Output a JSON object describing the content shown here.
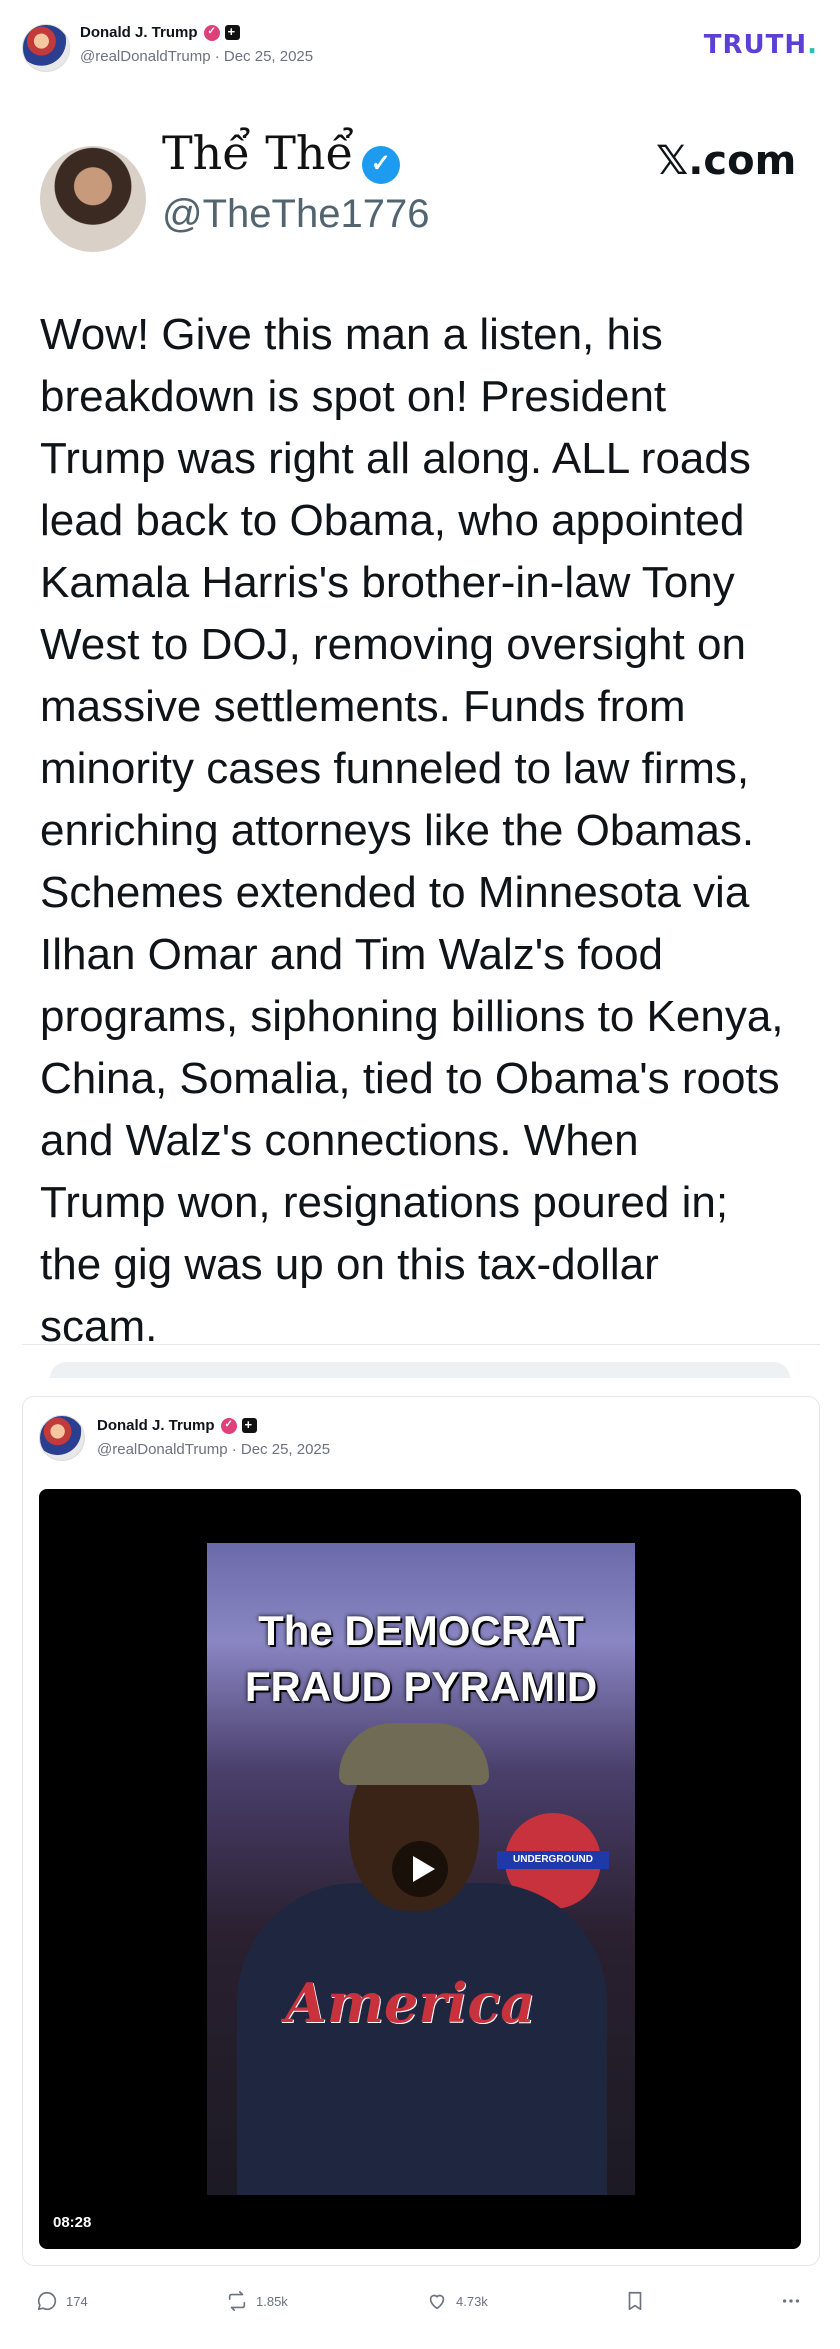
{
  "header": {
    "name": "Donald J. Trump",
    "handle_date": "@realDonaldTrump · Dec 25, 2025",
    "logo": "TRUTH",
    "logo_dot": "."
  },
  "embed": {
    "name": "Thể Thể",
    "handle": "@TheThe1776",
    "site": "𝕏.com",
    "lines": [
      "Wow!  Give this man a listen, his",
      "breakdown is spot on!  President",
      "Trump was right all along.  ALL roads",
      "lead back to Obama, who appointed",
      "Kamala Harris's brother-in-law Tony",
      "West to DOJ, removing oversight on",
      "massive settlements. Funds from",
      "minority cases funneled to law firms,",
      "enriching attorneys like the Obamas.",
      "Schemes extended to Minnesota via",
      "Ilhan Omar and Tim Walz's food",
      "programs, siphoning billions to Kenya,",
      "China, Somalia, tied to Obama's roots",
      "and Walz's connections.  When",
      "Trump won, resignations poured in;",
      "the gig was up on this tax-dollar",
      "scam."
    ]
  },
  "quoted_post": {
    "name": "Donald J. Trump",
    "handle_date": "@realDonaldTrump · Dec 25, 2025",
    "video": {
      "title_line1": "The DEMOCRAT",
      "title_line2": "FRAUD PYRAMID",
      "shirt_text": "America",
      "sign_text": "UNDERGROUND",
      "duration": "08:28"
    }
  },
  "actions": {
    "replies": "174",
    "retruths": "1.85k",
    "likes": "4.73k",
    "bookmark_icon": "bookmark-icon",
    "more_icon": "more-icon"
  },
  "colors": {
    "brand": "#5b3fd6",
    "verified_blue": "#1d9bf0",
    "badge_pink": "#e0407a"
  }
}
